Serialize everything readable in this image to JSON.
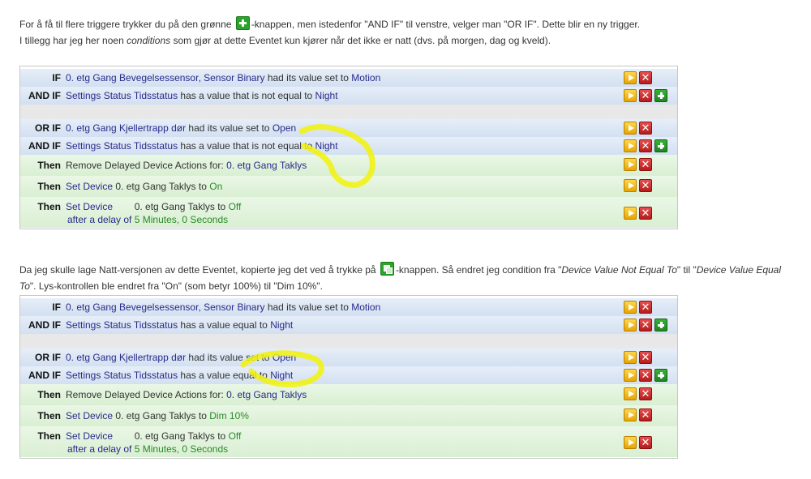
{
  "intro": {
    "line1_a": "For å få til flere triggere trykker du på den grønne",
    "line1_b": "-knappen, men istedenfor \"AND IF\" til venstre, velger man \"OR IF\". Dette blir en ny trigger.",
    "line2_a": "I tillegg har jeg her noen",
    "line2_em": "conditions",
    "line2_b": "som gjør at dette Eventet kun kjører når det ikke er natt (dvs. på morgen, dag og kveld)."
  },
  "middle": {
    "a": "Da jeg skulle lage Natt-versjonen av dette Eventet, kopierte jeg det ved å trykke på",
    "b": "-knappen. Så endret jeg condition fra \"",
    "em1": "Device Value Not Equal To",
    "c": "\" til \"",
    "em2": "Device Value Equal",
    "em3": "To",
    "d": "\". Lys-kontrollen ble endret fra \"On\" (som betyr 100%) til \"Dim 10%\"."
  },
  "panel1": {
    "r1": {
      "kw": "IF",
      "p1": "0. etg Gang Bevegelsessensor, Sensor Binary",
      "m": "had its value set to",
      "v": "Motion"
    },
    "r2": {
      "kw": "AND IF",
      "p1": "Settings Status Tidsstatus",
      "m": "has a value that is not equal to",
      "v": "Night"
    },
    "r3": {
      "kw": "OR IF",
      "p1": "0. etg Gang Kjellertrapp dør",
      "m": "had its value set to",
      "v": "Open"
    },
    "r4": {
      "kw": "AND IF",
      "p1": "Settings Status Tidsstatus",
      "m": "has a value that is not equal to",
      "v": "Night"
    },
    "r5": {
      "kw": "Then",
      "m": "Remove Delayed Device Actions for:",
      "v": "0. etg Gang Taklys"
    },
    "r6": {
      "kw": "Then",
      "a": "Set Device",
      "m": "0. etg Gang Taklys",
      "t": "to",
      "v": "On"
    },
    "r7": {
      "kw": "Then",
      "a": "Set Device",
      "m": "0. etg Gang Taklys",
      "t": "to",
      "v": "Off",
      "l2a": "after a delay of",
      "l2v": "5 Minutes, 0 Seconds"
    }
  },
  "panel2": {
    "r1": {
      "kw": "IF",
      "p1": "0. etg Gang Bevegelsessensor, Sensor Binary",
      "m": "had its value set to",
      "v": "Motion"
    },
    "r2": {
      "kw": "AND IF",
      "p1": "Settings Status Tidsstatus",
      "m": "has a value equal to",
      "v": "Night"
    },
    "r3": {
      "kw": "OR IF",
      "p1": "0. etg Gang Kjellertrapp dør",
      "m": "had its value set to",
      "v": "Open"
    },
    "r4": {
      "kw": "AND IF",
      "p1": "Settings Status Tidsstatus",
      "m": "has a value equal to",
      "v": "Night"
    },
    "r5": {
      "kw": "Then",
      "m": "Remove Delayed Device Actions for:",
      "v": "0. etg Gang Taklys"
    },
    "r6": {
      "kw": "Then",
      "a": "Set Device",
      "m": "0. etg Gang Taklys",
      "t": "to",
      "v": "Dim 10%"
    },
    "r7": {
      "kw": "Then",
      "a": "Set Device",
      "m": "0. etg Gang Taklys",
      "t": "to",
      "v": "Off",
      "l2a": "after a delay of",
      "l2v": "5 Minutes, 0 Seconds"
    }
  },
  "buttons": {
    "delete": "✕"
  },
  "icons": {
    "run": "play-icon",
    "delete": "close-icon",
    "add": "plus-icon",
    "copy": "copy-icon"
  },
  "colors": {
    "highlight": "#f2f20a",
    "condition_bg": "#dbe5f3",
    "action_bg": "#e1f3dc",
    "value_blue": "#2a2a8a",
    "value_green": "#2a8a2a"
  }
}
